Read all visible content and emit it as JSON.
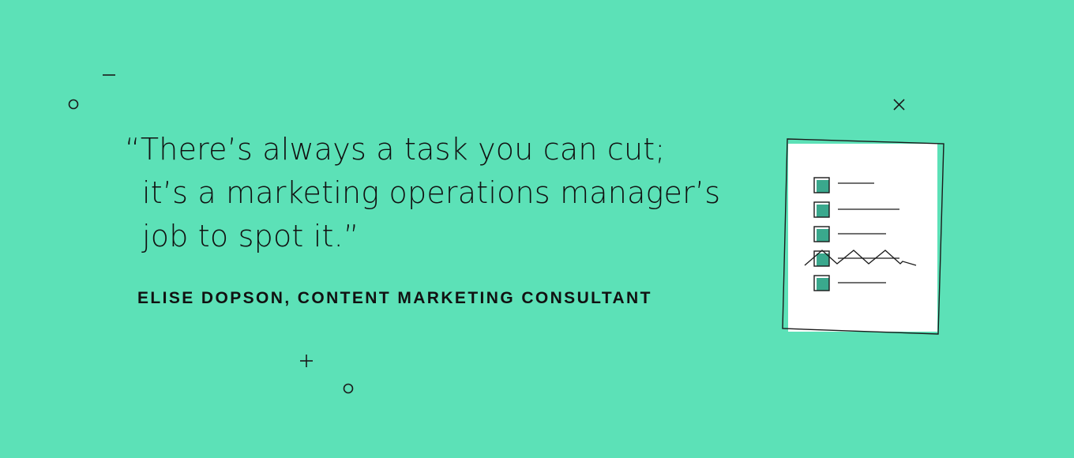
{
  "quote": {
    "line1": "“There’s always a task you can cut;",
    "line2": "it’s a marketing operations manager’s",
    "line3": "job to spot it.”"
  },
  "attribution": "ELISE DOPSON, CONTENT MARKETING CONSULTANT",
  "colors": {
    "background": "#5ce1b7",
    "text": "#111111",
    "checkbox_fill": "#3aa88d",
    "paper": "#ffffff"
  },
  "icons": [
    "checklist-icon",
    "circle-decoration-icon",
    "plus-decoration-icon",
    "cross-decoration-icon",
    "dash-decoration-icon"
  ]
}
